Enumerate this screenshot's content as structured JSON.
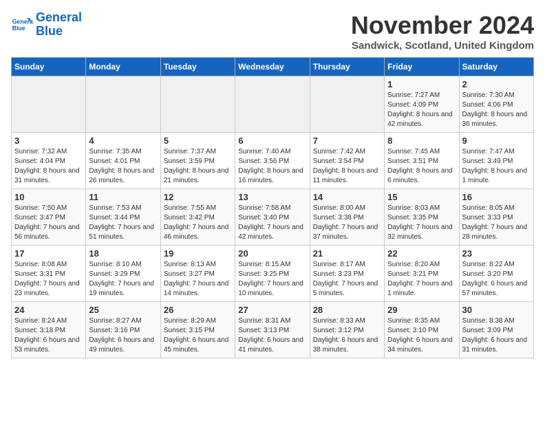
{
  "header": {
    "logo_line1": "General",
    "logo_line2": "Blue",
    "month_year": "November 2024",
    "location": "Sandwick, Scotland, United Kingdom"
  },
  "days_of_week": [
    "Sunday",
    "Monday",
    "Tuesday",
    "Wednesday",
    "Thursday",
    "Friday",
    "Saturday"
  ],
  "weeks": [
    [
      {
        "day": "",
        "info": ""
      },
      {
        "day": "",
        "info": ""
      },
      {
        "day": "",
        "info": ""
      },
      {
        "day": "",
        "info": ""
      },
      {
        "day": "",
        "info": ""
      },
      {
        "day": "1",
        "info": "Sunrise: 7:27 AM\nSunset: 4:09 PM\nDaylight: 8 hours and 42 minutes."
      },
      {
        "day": "2",
        "info": "Sunrise: 7:30 AM\nSunset: 4:06 PM\nDaylight: 8 hours and 36 minutes."
      }
    ],
    [
      {
        "day": "3",
        "info": "Sunrise: 7:32 AM\nSunset: 4:04 PM\nDaylight: 8 hours and 31 minutes."
      },
      {
        "day": "4",
        "info": "Sunrise: 7:35 AM\nSunset: 4:01 PM\nDaylight: 8 hours and 26 minutes."
      },
      {
        "day": "5",
        "info": "Sunrise: 7:37 AM\nSunset: 3:59 PM\nDaylight: 8 hours and 21 minutes."
      },
      {
        "day": "6",
        "info": "Sunrise: 7:40 AM\nSunset: 3:56 PM\nDaylight: 8 hours and 16 minutes."
      },
      {
        "day": "7",
        "info": "Sunrise: 7:42 AM\nSunset: 3:54 PM\nDaylight: 8 hours and 11 minutes."
      },
      {
        "day": "8",
        "info": "Sunrise: 7:45 AM\nSunset: 3:51 PM\nDaylight: 8 hours and 6 minutes."
      },
      {
        "day": "9",
        "info": "Sunrise: 7:47 AM\nSunset: 3:49 PM\nDaylight: 8 hours and 1 minute."
      }
    ],
    [
      {
        "day": "10",
        "info": "Sunrise: 7:50 AM\nSunset: 3:47 PM\nDaylight: 7 hours and 56 minutes."
      },
      {
        "day": "11",
        "info": "Sunrise: 7:53 AM\nSunset: 3:44 PM\nDaylight: 7 hours and 51 minutes."
      },
      {
        "day": "12",
        "info": "Sunrise: 7:55 AM\nSunset: 3:42 PM\nDaylight: 7 hours and 46 minutes."
      },
      {
        "day": "13",
        "info": "Sunrise: 7:58 AM\nSunset: 3:40 PM\nDaylight: 7 hours and 42 minutes."
      },
      {
        "day": "14",
        "info": "Sunrise: 8:00 AM\nSunset: 3:38 PM\nDaylight: 7 hours and 37 minutes."
      },
      {
        "day": "15",
        "info": "Sunrise: 8:03 AM\nSunset: 3:35 PM\nDaylight: 7 hours and 32 minutes."
      },
      {
        "day": "16",
        "info": "Sunrise: 8:05 AM\nSunset: 3:33 PM\nDaylight: 7 hours and 28 minutes."
      }
    ],
    [
      {
        "day": "17",
        "info": "Sunrise: 8:08 AM\nSunset: 3:31 PM\nDaylight: 7 hours and 23 minutes."
      },
      {
        "day": "18",
        "info": "Sunrise: 8:10 AM\nSunset: 3:29 PM\nDaylight: 7 hours and 19 minutes."
      },
      {
        "day": "19",
        "info": "Sunrise: 8:13 AM\nSunset: 3:27 PM\nDaylight: 7 hours and 14 minutes."
      },
      {
        "day": "20",
        "info": "Sunrise: 8:15 AM\nSunset: 3:25 PM\nDaylight: 7 hours and 10 minutes."
      },
      {
        "day": "21",
        "info": "Sunrise: 8:17 AM\nSunset: 3:23 PM\nDaylight: 7 hours and 5 minutes."
      },
      {
        "day": "22",
        "info": "Sunrise: 8:20 AM\nSunset: 3:21 PM\nDaylight: 7 hours and 1 minute."
      },
      {
        "day": "23",
        "info": "Sunrise: 8:22 AM\nSunset: 3:20 PM\nDaylight: 6 hours and 57 minutes."
      }
    ],
    [
      {
        "day": "24",
        "info": "Sunrise: 8:24 AM\nSunset: 3:18 PM\nDaylight: 6 hours and 53 minutes."
      },
      {
        "day": "25",
        "info": "Sunrise: 8:27 AM\nSunset: 3:16 PM\nDaylight: 6 hours and 49 minutes."
      },
      {
        "day": "26",
        "info": "Sunrise: 8:29 AM\nSunset: 3:15 PM\nDaylight: 6 hours and 45 minutes."
      },
      {
        "day": "27",
        "info": "Sunrise: 8:31 AM\nSunset: 3:13 PM\nDaylight: 6 hours and 41 minutes."
      },
      {
        "day": "28",
        "info": "Sunrise: 8:33 AM\nSunset: 3:12 PM\nDaylight: 6 hours and 38 minutes."
      },
      {
        "day": "29",
        "info": "Sunrise: 8:35 AM\nSunset: 3:10 PM\nDaylight: 6 hours and 34 minutes."
      },
      {
        "day": "30",
        "info": "Sunrise: 8:38 AM\nSunset: 3:09 PM\nDaylight: 6 hours and 31 minutes."
      }
    ]
  ]
}
